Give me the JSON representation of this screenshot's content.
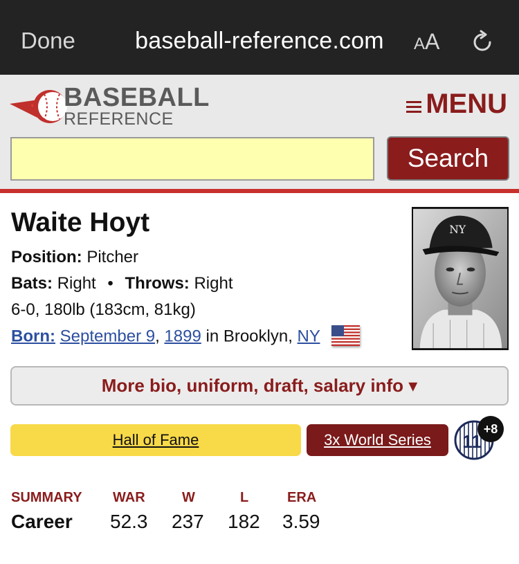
{
  "browser": {
    "done_label": "Done",
    "url": "baseball-reference.com",
    "text_size_small": "A",
    "text_size_big": "A",
    "reload_icon": "reload-icon"
  },
  "site": {
    "logo_line1": "BASEBALL",
    "logo_line2": "REFERENCE",
    "menu_label": "MENU",
    "search_value": "",
    "search_button": "Search",
    "accent_color": "#8a1c1c"
  },
  "player": {
    "name": "Waite Hoyt",
    "position_label": "Position:",
    "position": "Pitcher",
    "bats_label": "Bats:",
    "bats": "Right",
    "dot": "•",
    "throws_label": "Throws:",
    "throws": "Right",
    "measurements": "6-0, 180lb (183cm, 81kg)",
    "born_label": "Born:",
    "born_date": "September 9",
    "comma": ",",
    "born_year": "1899",
    "born_in": "in Brooklyn,",
    "born_state": "NY",
    "more_bio": "More bio, uniform, draft, salary info ▾"
  },
  "badges": {
    "hall_of_fame": "Hall of Fame",
    "world_series": "3x World Series",
    "jersey_number": "11",
    "more_numbers": "+8"
  },
  "summary": {
    "header": "SUMMARY",
    "row_label": "Career",
    "columns": [
      "WAR",
      "W",
      "L",
      "ERA"
    ],
    "values": [
      "52.3",
      "237",
      "182",
      "3.59"
    ]
  }
}
